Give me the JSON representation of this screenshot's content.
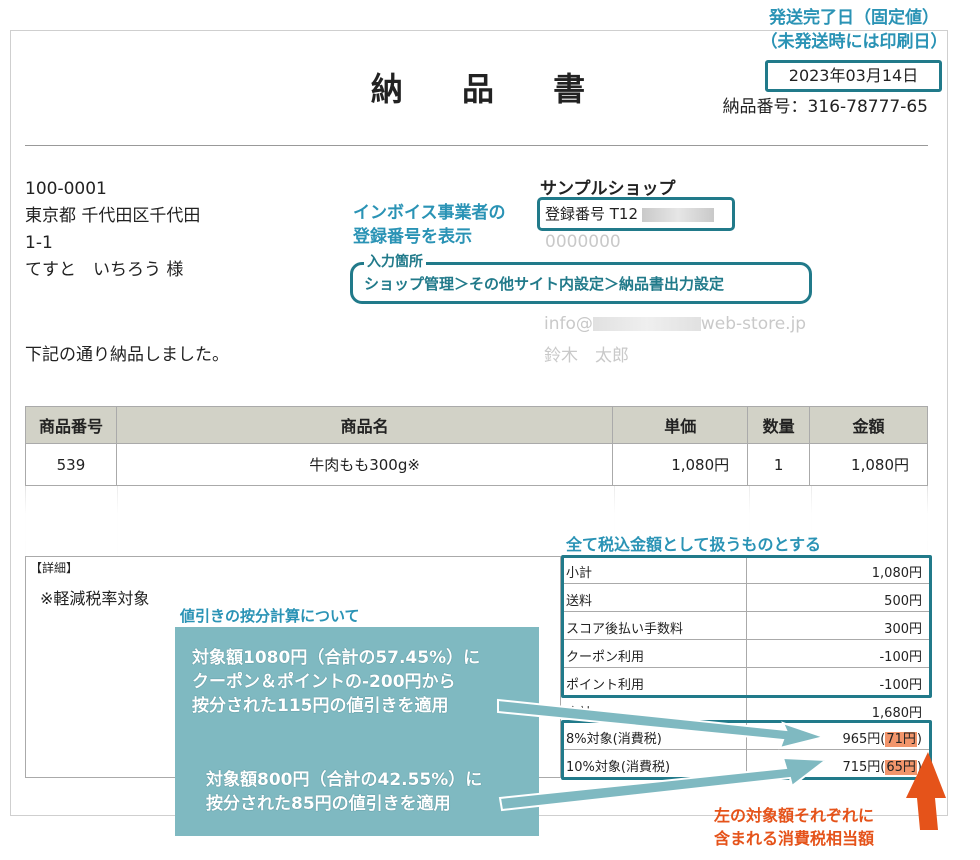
{
  "header": {
    "title": "納 品 書",
    "ship_note_line1": "発送完了日（固定値）",
    "ship_note_line2": "（未発送時には印刷日）",
    "ship_date": "2023年03月14日",
    "doc_no": "納品番号：316-78777-65"
  },
  "recipient": {
    "postal": "100-0001",
    "address1": "東京都 千代田区千代田",
    "address2": "1-1",
    "name": "てすと　いちろう 様"
  },
  "greeting": "下記の通り納品しました。",
  "shop": {
    "name": "サンプルショップ",
    "reg_label": "登録番号 T12",
    "reg_line2": "0000000",
    "email_prefix": "info@",
    "email_suffix": "web-store.jp",
    "person": "鈴木　太郎"
  },
  "annotations": {
    "invoice_line1": "インボイス事業者の",
    "invoice_line2": "登録番号を表示",
    "input_label": "入力箇所",
    "input_path": "ショップ管理＞その他サイト内設定＞納品書出力設定",
    "tax_included": "全て税込金額として扱うものとする",
    "discount_caption": "値引きの按分計算について",
    "note1_line1": "対象額1080円（合計の57.45%）に",
    "note1_line2": "クーポン＆ポイントの-200円から",
    "note1_line3": "按分された115円の値引きを適用",
    "note2_line1": "対象額800円（合計の42.55%）に",
    "note2_line2": "按分された85円の値引きを適用",
    "corner_line1": "左の対象額それぞれに",
    "corner_line2": "含まれる消費税相当額"
  },
  "items_table": {
    "headers": [
      "商品番号",
      "商品名",
      "単価",
      "数量",
      "金額"
    ],
    "rows": [
      {
        "code": "539",
        "name": "牛肉もも300g※",
        "unit_price": "1,080円",
        "qty": "1",
        "amount": "1,080円"
      }
    ]
  },
  "details": {
    "heading": "【詳細】",
    "note": "※軽減税率対象"
  },
  "summary": {
    "subtotal_label": "小計",
    "subtotal": "1,080円",
    "shipping_label": "送料",
    "shipping": "500円",
    "fee_label": "スコア後払い手数料",
    "fee": "300円",
    "coupon_label": "クーポン利用",
    "coupon": "-100円",
    "point_label": "ポイント利用",
    "point": "-100円",
    "total_label": "合計",
    "total": "1,680円",
    "tax8_label": "8%対象(消費税)",
    "tax8_base": "965円(",
    "tax8_tax": "71円",
    "tax8_close": ")",
    "tax10_label": "10%対象(消費税)",
    "tax10_base": "715円(",
    "tax10_tax": "65円",
    "tax10_close": ")"
  },
  "colors": {
    "annotation_blue": "#2a93b5",
    "frame_teal": "#217a8a",
    "panel_teal": "#7fb9c1",
    "table_header": "#d2d2c7",
    "highlight_orange": "#f2956b",
    "note_orange": "#e5531a"
  }
}
